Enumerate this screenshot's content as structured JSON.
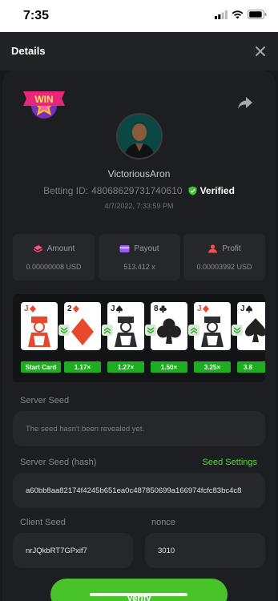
{
  "status_bar": {
    "time": "7:35"
  },
  "header": {
    "title": "Details"
  },
  "player": {
    "username": "VictoriousAron",
    "betting_id_label": "Betting ID:",
    "betting_id": "48068629731740610",
    "verified_label": "Verified",
    "date": "4/7/2022, 7:33:59 PM"
  },
  "stats": [
    {
      "label": "Amount",
      "value": "0.00000008 USD",
      "icon": "coins-icon"
    },
    {
      "label": "Payout",
      "value": "513.412 x",
      "icon": "wallet-icon"
    },
    {
      "label": "Profit",
      "value": "0.00003992 USD",
      "icon": "profit-icon"
    }
  ],
  "cards": [
    {
      "rank": "J",
      "suit": "diamond",
      "color": "#e8492d"
    },
    {
      "rank": "2",
      "suit": "diamond",
      "color": "#e8492d"
    },
    {
      "rank": "J",
      "suit": "spade",
      "color": "#222222"
    },
    {
      "rank": "8",
      "suit": "club",
      "color": "#222222"
    },
    {
      "rank": "J",
      "suit": "diamond",
      "color": "#e8492d"
    },
    {
      "rank": "J",
      "suit": "spade",
      "color": "#222222"
    }
  ],
  "multipliers": [
    "Start Card",
    "1.17×",
    "1.27×",
    "1.50×",
    "3.25×",
    "3.8"
  ],
  "server_seed": {
    "label": "Server Seed",
    "placeholder": "The seed hasn't been revealed yet."
  },
  "server_seed_hash": {
    "label": "Server Seed (hash)",
    "link_label": "Seed Settings",
    "value": "a60bb8aa82174f4245b651ea0c487850699a166974fcfc83bc4c8"
  },
  "client_seed": {
    "label": "Client Seed",
    "value": "nrJQkbRT7GPxif7"
  },
  "nonce": {
    "label": "nonce",
    "value": "3010"
  },
  "verify_label": "Verify",
  "colors": {
    "accent": "#48c42a",
    "background": "#17181b",
    "panel": "#26272b"
  }
}
